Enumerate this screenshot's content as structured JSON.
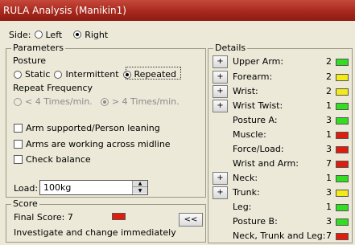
{
  "window": {
    "title": "RULA Analysis (Manikin1)"
  },
  "side": {
    "label": "Side:",
    "options": [
      {
        "label": "Left",
        "selected": false
      },
      {
        "label": "Right",
        "selected": true
      }
    ]
  },
  "parameters": {
    "title": "Parameters",
    "posture": {
      "label": "Posture",
      "options": [
        {
          "label": "Static",
          "selected": false
        },
        {
          "label": "Intermittent",
          "selected": false
        },
        {
          "label": "Repeated",
          "selected": true
        }
      ]
    },
    "repeat_frequency": {
      "label": "Repeat Frequency",
      "options": [
        {
          "label": "< 4 Times/min.",
          "selected": false
        },
        {
          "label": "> 4 Times/min.",
          "selected": true
        }
      ]
    },
    "checks": [
      {
        "label": "Arm supported/Person leaning",
        "checked": false
      },
      {
        "label": "Arms are working across midline",
        "checked": false
      },
      {
        "label": "Check balance",
        "checked": false
      }
    ],
    "load": {
      "label": "Load:",
      "value": "100kg"
    }
  },
  "score": {
    "title": "Score",
    "final_label": "Final Score: 7",
    "final_color": "#e01c0d",
    "message": "Investigate and change immediately",
    "back_button": "<<"
  },
  "details": {
    "title": "Details",
    "rows": [
      {
        "name": "Upper Arm:",
        "value": "2",
        "color": "#33dd22",
        "expandable": true,
        "icon": "plus-icon"
      },
      {
        "name": "Forearm:",
        "value": "2",
        "color": "#f2ea19",
        "expandable": true,
        "icon": "plus-icon"
      },
      {
        "name": "Wrist:",
        "value": "2",
        "color": "#f2ea19",
        "expandable": true,
        "icon": "plus-icon"
      },
      {
        "name": "Wrist Twist:",
        "value": "1",
        "color": "#33dd22",
        "expandable": true,
        "icon": "plus-icon"
      },
      {
        "name": "Posture A:",
        "value": "3",
        "color": "#33dd22",
        "expandable": false
      },
      {
        "name": "Muscle:",
        "value": "1",
        "color": "#e01c0d",
        "expandable": false
      },
      {
        "name": "Force/Load:",
        "value": "3",
        "color": "#e01c0d",
        "expandable": false
      },
      {
        "name": "Wrist and Arm:",
        "value": "7",
        "color": "#e01c0d",
        "expandable": false
      },
      {
        "name": "Neck:",
        "value": "1",
        "color": "#33dd22",
        "expandable": true,
        "icon": "plus-icon"
      },
      {
        "name": "Trunk:",
        "value": "3",
        "color": "#f2ea19",
        "expandable": true,
        "icon": "plus-icon"
      },
      {
        "name": "Leg:",
        "value": "1",
        "color": "#33dd22",
        "expandable": false
      },
      {
        "name": "Posture B:",
        "value": "3",
        "color": "#33dd22",
        "expandable": false
      },
      {
        "name": "Neck, Trunk and Leg:",
        "value": "7",
        "color": "#e01c0d",
        "expandable": false
      }
    ]
  }
}
